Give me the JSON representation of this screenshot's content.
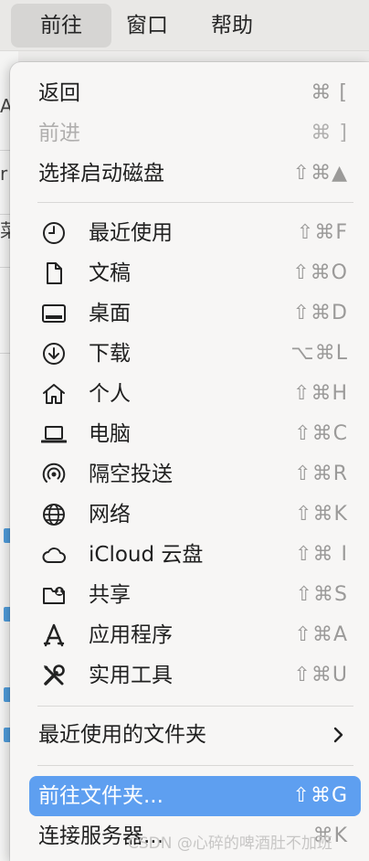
{
  "menubar": {
    "items": [
      {
        "label": "前往",
        "active": true
      },
      {
        "label": "窗口",
        "active": false
      },
      {
        "label": "帮助",
        "active": false
      }
    ]
  },
  "background_window": {
    "fragments": [
      "A",
      "r",
      "菜"
    ]
  },
  "menu": {
    "items": [
      {
        "label": "返回",
        "shortcut": "⌘ [",
        "disabled": false
      },
      {
        "label": "前进",
        "shortcut": "⌘ ]",
        "disabled": true
      },
      {
        "label": "选择启动磁盘",
        "shortcut": "⇧⌘▲",
        "disabled": false
      },
      {
        "label": "最近使用",
        "shortcut": "⇧⌘F",
        "icon": "clock-icon"
      },
      {
        "label": "文稿",
        "shortcut": "⇧⌘O",
        "icon": "document-icon"
      },
      {
        "label": "桌面",
        "shortcut": "⇧⌘D",
        "icon": "desktop-icon"
      },
      {
        "label": "下载",
        "shortcut": "⌥⌘L",
        "icon": "download-icon"
      },
      {
        "label": "个人",
        "shortcut": "⇧⌘H",
        "icon": "home-icon"
      },
      {
        "label": "电脑",
        "shortcut": "⇧⌘C",
        "icon": "laptop-icon"
      },
      {
        "label": "隔空投送",
        "shortcut": "⇧⌘R",
        "icon": "airdrop-icon"
      },
      {
        "label": "网络",
        "shortcut": "⇧⌘K",
        "icon": "globe-icon"
      },
      {
        "label": "iCloud 云盘",
        "shortcut": "⇧⌘ I",
        "icon": "cloud-icon"
      },
      {
        "label": "共享",
        "shortcut": "⇧⌘S",
        "icon": "shared-folder-icon"
      },
      {
        "label": "应用程序",
        "shortcut": "⇧⌘A",
        "icon": "applications-icon"
      },
      {
        "label": "实用工具",
        "shortcut": "⇧⌘U",
        "icon": "tools-icon"
      },
      {
        "label": "最近使用的文件夹",
        "submenu": true
      },
      {
        "label": "前往文件夹...",
        "shortcut": "⇧⌘G",
        "highlighted": true
      },
      {
        "label": "连接服务器...",
        "shortcut": "⌘K"
      }
    ]
  },
  "watermark": "CSDN @心碎的啤酒肚不加班",
  "colors": {
    "highlight": "#5e9ff0",
    "menu_bg": "#f7f6f5",
    "shortcut": "#9b9a99",
    "disabled": "#b0afae"
  }
}
